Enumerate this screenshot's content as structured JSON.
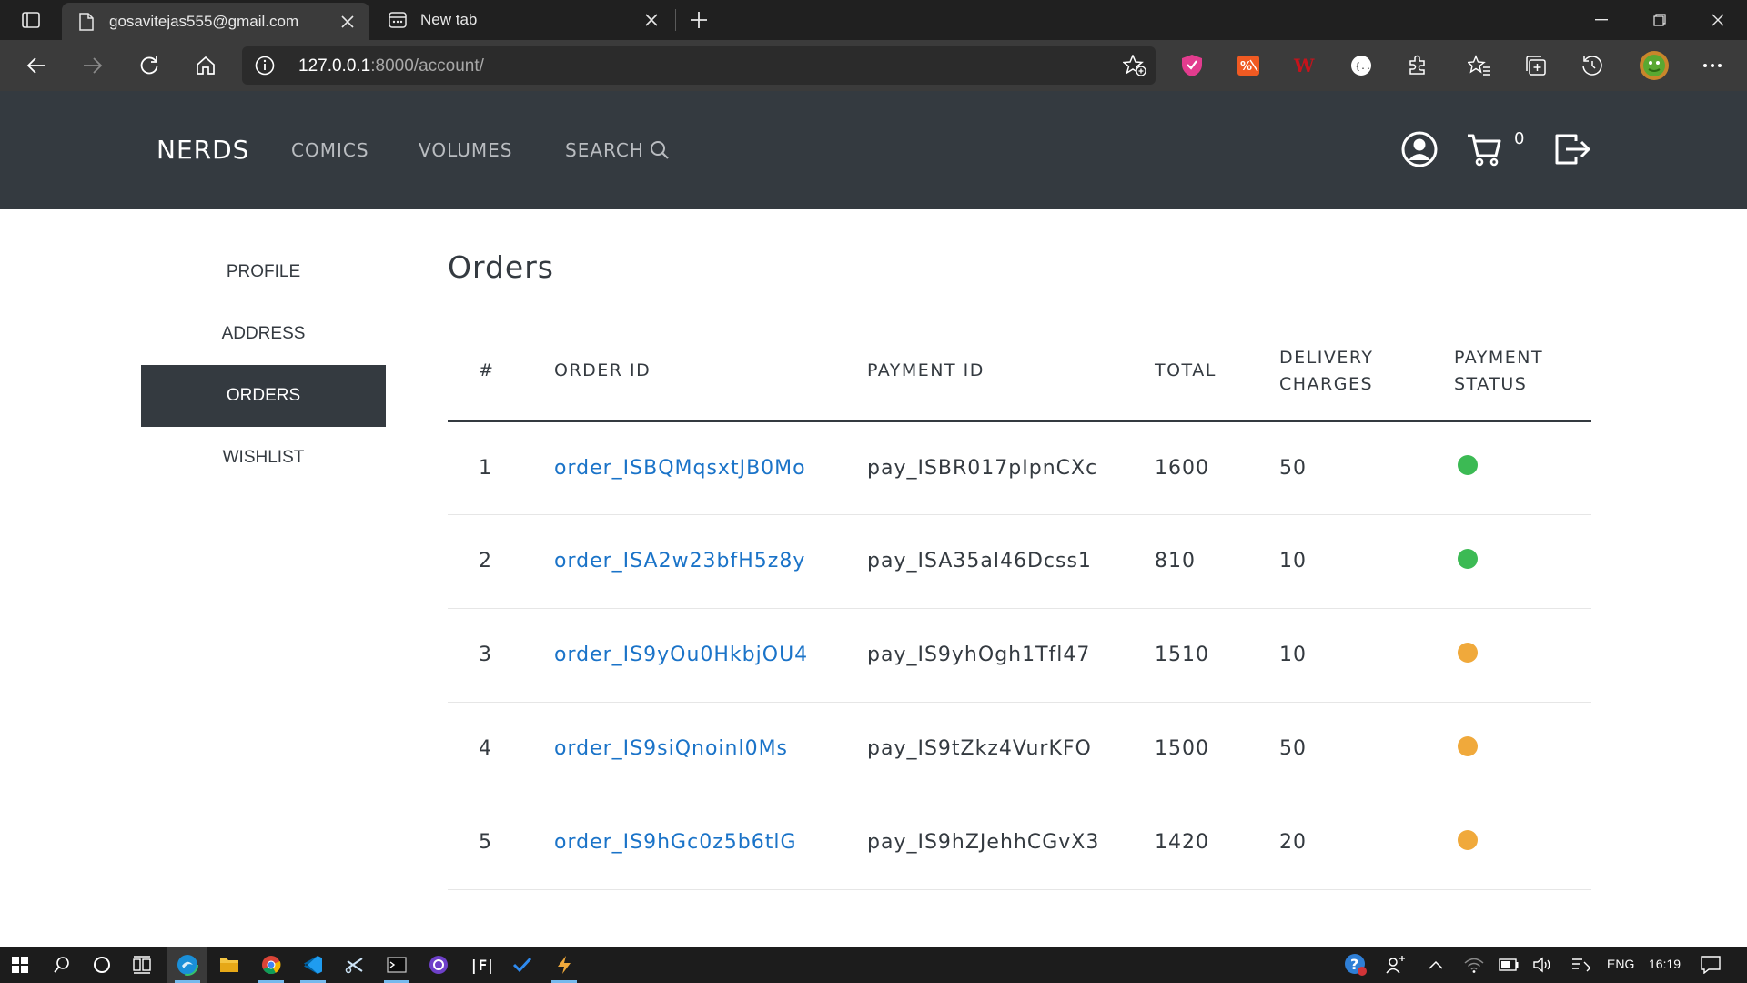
{
  "browser": {
    "tabs": [
      {
        "title": "gosavitejas555@gmail.com",
        "active": true
      },
      {
        "title": "New tab",
        "active": false
      }
    ],
    "address": {
      "host": "127.0.0.1",
      "rest": ":8000/account/"
    }
  },
  "site": {
    "brand": "NERDS",
    "nav": {
      "comics": "COMICS",
      "volumes": "VOLUMES",
      "search": "SEARCH"
    },
    "cart_count": "0"
  },
  "sidebar": {
    "items": [
      {
        "label": "PROFILE",
        "active": false
      },
      {
        "label": "ADDRESS",
        "active": false
      },
      {
        "label": "ORDERS",
        "active": true
      },
      {
        "label": "WISHLIST",
        "active": false
      }
    ]
  },
  "orders": {
    "title": "Orders",
    "columns": {
      "num": "#",
      "order_id": "ORDER ID",
      "payment_id": "PAYMENT ID",
      "total": "TOTAL",
      "delivery_1": "DELIVERY",
      "delivery_2": "CHARGES",
      "status_1": "PAYMENT",
      "status_2": "STATUS"
    },
    "rows": [
      {
        "num": "1",
        "order_id": "order_ISBQMqsxtJB0Mo",
        "payment_id": "pay_ISBR017pIpnCXc",
        "total": "1600",
        "delivery": "50",
        "status_color": "#3cba54"
      },
      {
        "num": "2",
        "order_id": "order_ISA2w23bfH5z8y",
        "payment_id": "pay_ISA35al46Dcss1",
        "total": "810",
        "delivery": "10",
        "status_color": "#3cba54"
      },
      {
        "num": "3",
        "order_id": "order_IS9yOu0HkbjOU4",
        "payment_id": "pay_IS9yhOgh1Tfl47",
        "total": "1510",
        "delivery": "10",
        "status_color": "#f0a93b"
      },
      {
        "num": "4",
        "order_id": "order_IS9siQnoinl0Ms",
        "payment_id": "pay_IS9tZkz4VurKFO",
        "total": "1500",
        "delivery": "50",
        "status_color": "#f0a93b"
      },
      {
        "num": "5",
        "order_id": "order_IS9hGc0z5b6tlG",
        "payment_id": "pay_IS9hZJehhCGvX3",
        "total": "1420",
        "delivery": "20",
        "status_color": "#f0a93b"
      }
    ]
  },
  "taskbar": {
    "language": "ENG",
    "time": "16:19"
  }
}
